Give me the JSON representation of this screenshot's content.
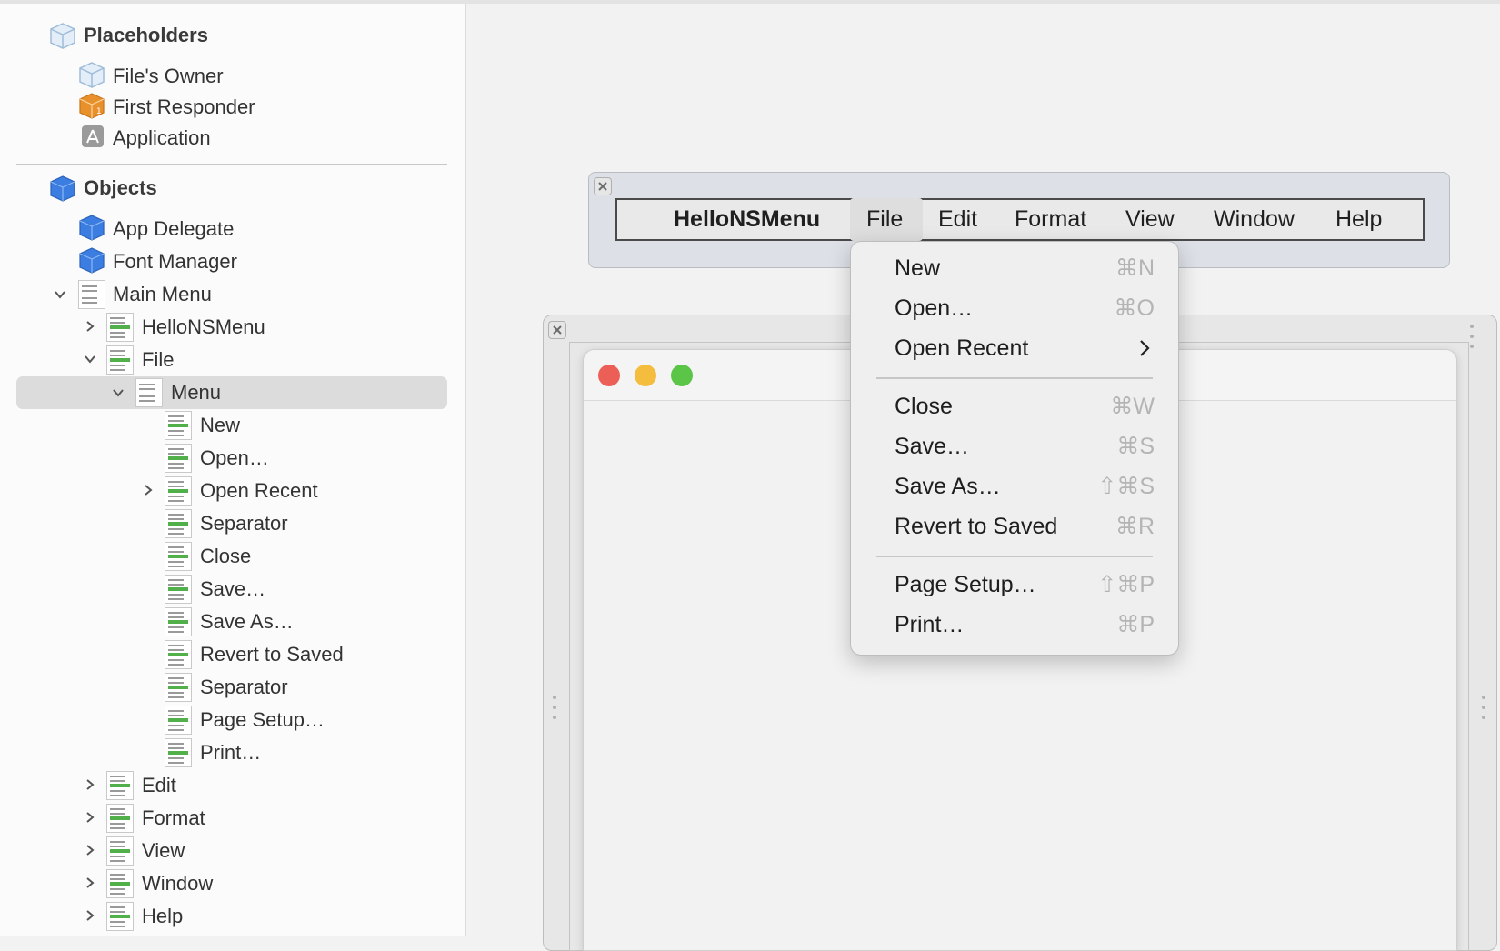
{
  "outline": {
    "placeholders_title": "Placeholders",
    "placeholders": [
      {
        "label": "File's Owner",
        "icon": "placeholder-cube-icon"
      },
      {
        "label": "First Responder",
        "icon": "first-responder-icon"
      },
      {
        "label": "Application",
        "icon": "application-icon"
      }
    ],
    "objects_title": "Objects",
    "objects": [
      {
        "label": "App Delegate",
        "icon": "object-cube-icon"
      },
      {
        "label": "Font Manager",
        "icon": "object-cube-icon"
      }
    ],
    "main_menu": "Main Menu",
    "menu_children": [
      "HelloNSMenu",
      "File"
    ],
    "file_menu": "Menu",
    "file_items": [
      "New",
      "Open…",
      "Open Recent",
      "Separator",
      "Close",
      "Save…",
      "Save As…",
      "Revert to Saved",
      "Separator",
      "Page Setup…",
      "Print…"
    ],
    "other_menus": [
      "Edit",
      "Format",
      "View",
      "Window",
      "Help"
    ]
  },
  "menubar": {
    "app_name": "HelloNSMenu",
    "items": [
      "File",
      "Edit",
      "Format",
      "View",
      "Window",
      "Help"
    ]
  },
  "file_dropdown": {
    "items": [
      {
        "label": "New",
        "shortcut": "⌘N"
      },
      {
        "label": "Open…",
        "shortcut": "⌘O"
      },
      {
        "label": "Open Recent",
        "shortcut": ""
      },
      {
        "label": "Close",
        "shortcut": "⌘W"
      },
      {
        "label": "Save…",
        "shortcut": "⌘S"
      },
      {
        "label": "Save As…",
        "shortcut": "⇧⌘S"
      },
      {
        "label": "Revert to Saved",
        "shortcut": "⌘R"
      },
      {
        "label": "Page Setup…",
        "shortcut": "⇧⌘P"
      },
      {
        "label": "Print…",
        "shortcut": "⌘P"
      }
    ]
  },
  "colors": {
    "object_blue": "#3b7de0",
    "first_responder_orange": "#e8912c",
    "selection_gray": "#dcdcdc",
    "traffic_red": "#ec5f57",
    "traffic_yellow": "#f4bd3d",
    "traffic_green": "#5bc548",
    "thumb_green": "#52b04a"
  }
}
